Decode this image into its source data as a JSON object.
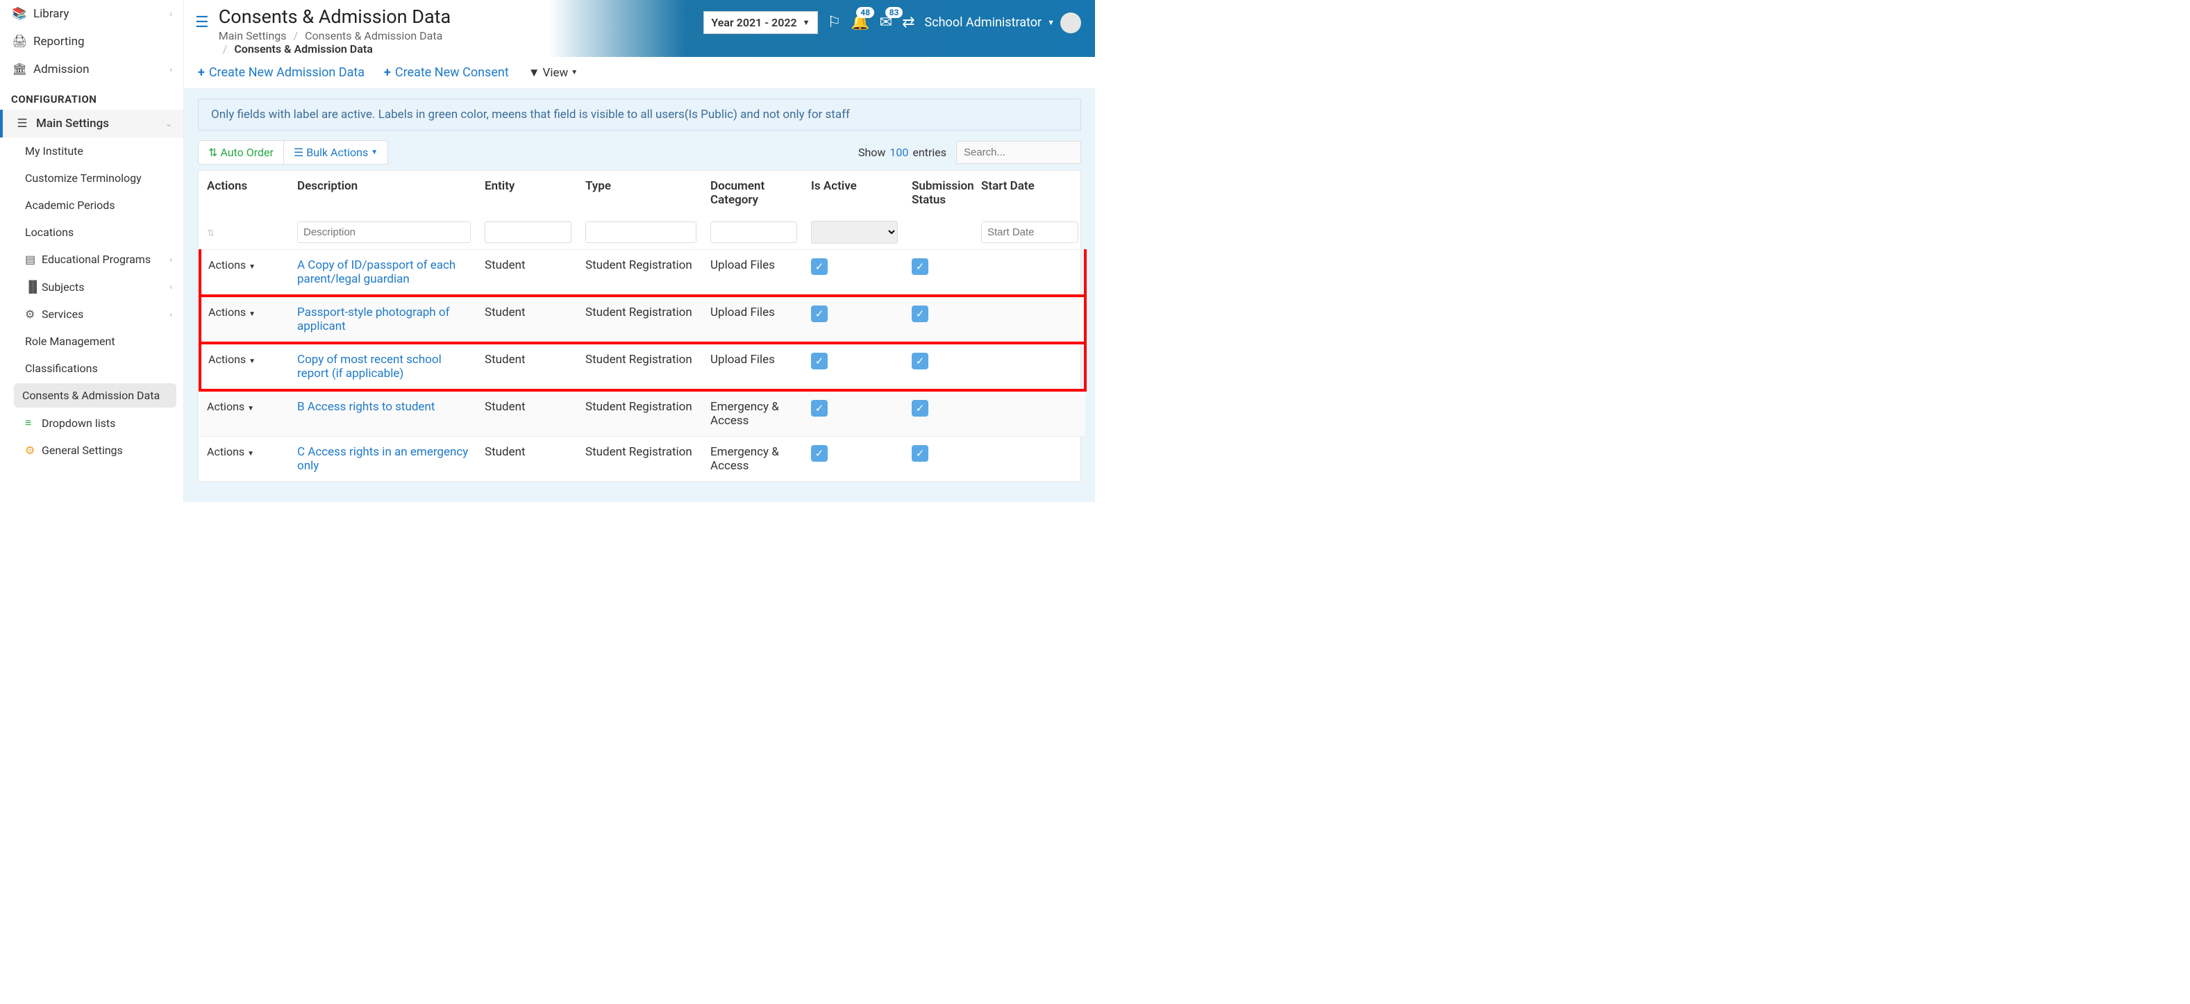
{
  "sidebar": {
    "top": [
      {
        "icon": "📚",
        "label": "Library",
        "chev": "‹"
      },
      {
        "icon": "🖨",
        "label": "Reporting"
      },
      {
        "icon": "🏛",
        "label": "Admission",
        "chev": "‹"
      }
    ],
    "heading": "CONFIGURATION",
    "main_settings_label": "Main Settings",
    "subs": [
      {
        "label": "My Institute"
      },
      {
        "label": "Customize Terminology"
      },
      {
        "label": "Academic Periods"
      },
      {
        "label": "Locations"
      },
      {
        "label": "Educational Programs",
        "icon": "▤",
        "chev": "‹"
      },
      {
        "label": "Subjects",
        "icon": "▐▌",
        "chev": "‹"
      },
      {
        "label": "Services",
        "icon": "⚙",
        "chev": "‹"
      },
      {
        "label": "Role Management"
      },
      {
        "label": "Classifications"
      },
      {
        "label": "Consents & Admission Data",
        "active": true
      },
      {
        "label": "Dropdown lists",
        "icon": "≡",
        "icolor": "#28a745"
      },
      {
        "label": "General Settings",
        "icon": "⚙",
        "icolor": "#f0a020"
      }
    ]
  },
  "header": {
    "title": "Consents & Admission Data",
    "crumb1": "Main Settings",
    "crumb2": "Consents & Admission Data",
    "crumb3": "Consents & Admission Data",
    "year": "Year 2021 - 2022",
    "badge1": "48",
    "badge2": "83",
    "user": "School Administrator"
  },
  "actions": {
    "create_admission": "Create New Admission Data",
    "create_consent": "Create New Consent",
    "view": "View"
  },
  "info": "Only fields with label are active. Labels in green color, meens that field is visible to all users(Is Public) and not only for staff",
  "toolbar": {
    "auto_order": "Auto Order",
    "bulk": "Bulk Actions",
    "show": "Show",
    "entries_num": "100",
    "entries_lbl": "entries",
    "search_ph": "Search..."
  },
  "cols": {
    "actions": "Actions",
    "description": "Description",
    "entity": "Entity",
    "type": "Type",
    "category": "Document Category",
    "active": "Is Active",
    "submission": "Submission Status",
    "start": "Start Date"
  },
  "filters": {
    "desc_ph": "Description",
    "start_ph": "Start Date"
  },
  "rows": [
    {
      "desc": "A Copy of ID/passport of each parent/legal guardian",
      "entity": "Student",
      "type": "Student Registration",
      "cat": "Upload Files",
      "hl": true
    },
    {
      "desc": "Passport-style photograph of applicant",
      "entity": "Student",
      "type": "Student Registration",
      "cat": "Upload Files",
      "hl": true
    },
    {
      "desc": "Copy of most recent school report (if applicable)",
      "entity": "Student",
      "type": "Student Registration",
      "cat": "Upload Files",
      "hl": true
    },
    {
      "desc": "B Access rights to student",
      "entity": "Student",
      "type": "Student Registration",
      "cat": "Emergency & Access",
      "hl": false
    },
    {
      "desc": "C Access rights in an emergency only",
      "entity": "Student",
      "type": "Student Registration",
      "cat": "Emergency & Access",
      "hl": false
    }
  ],
  "row_action_label": "Actions"
}
